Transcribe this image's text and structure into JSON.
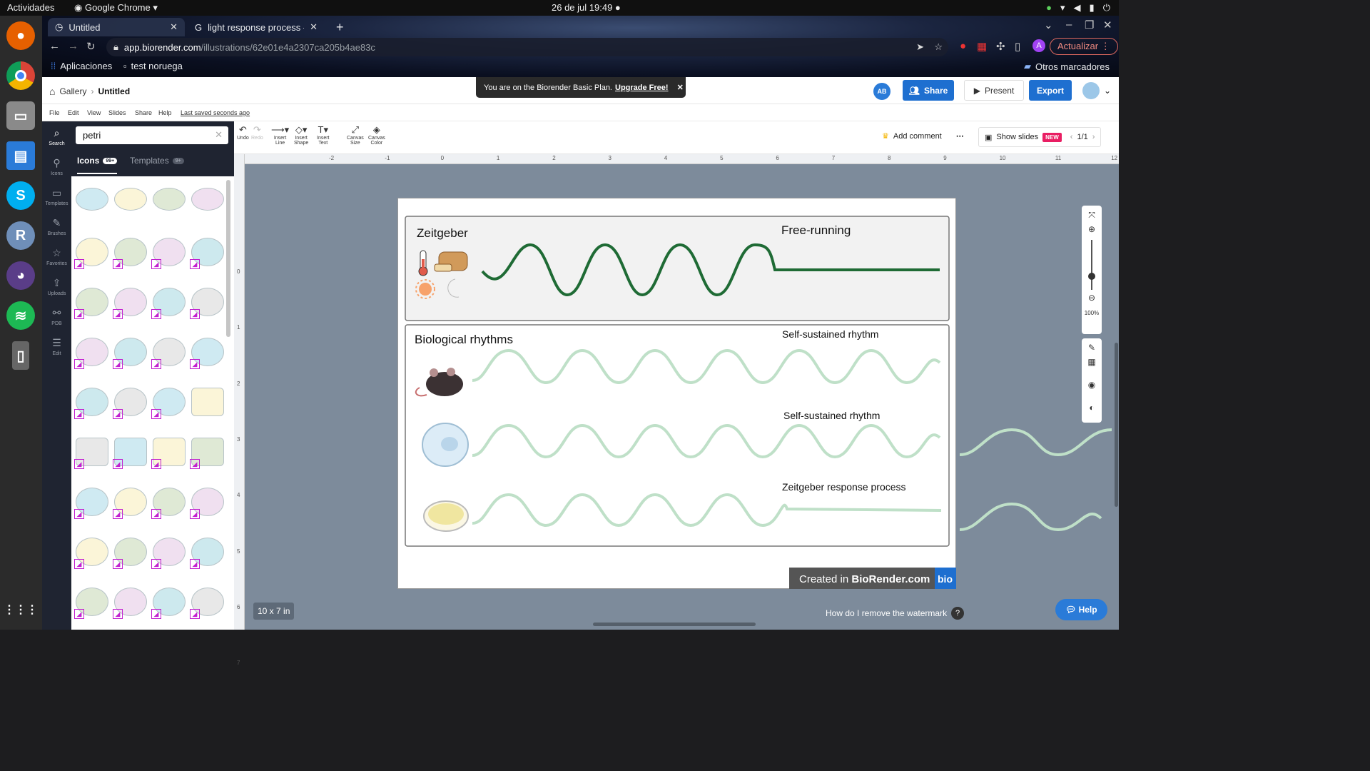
{
  "os": {
    "activities": "Actividades",
    "app_name": "Google Chrome",
    "clock": "26 de jul  19:49"
  },
  "browser": {
    "tabs": [
      {
        "title": "Untitled"
      },
      {
        "title": "light response process - B"
      }
    ],
    "url_host": "app.biorender.com",
    "url_path": "/illustrations/62e01e4a2307ca205b4ae83c",
    "update_label": "Actualizar",
    "profile_initial": "A",
    "bookmarks": [
      {
        "label": "Aplicaciones"
      },
      {
        "label": "test noruega"
      }
    ],
    "other_bookmarks": "Otros marcadores"
  },
  "header": {
    "gallery": "Gallery",
    "doc_title": "Untitled",
    "banner_text": "You are on the Biorender Basic Plan.",
    "banner_link": "Upgrade Free!",
    "avatar": "AB",
    "share": "Share",
    "present": "Present",
    "export": "Export"
  },
  "menu": {
    "items": [
      "File",
      "Edit",
      "View",
      "Slides",
      "Share",
      "Help"
    ],
    "saved": "Last saved seconds ago"
  },
  "rail": [
    {
      "label": "Search",
      "icon": "search-icon"
    },
    {
      "label": "Icons",
      "icon": "icons-icon"
    },
    {
      "label": "Templates",
      "icon": "templates-icon"
    },
    {
      "label": "Brushes",
      "icon": "brush-icon"
    },
    {
      "label": "Favorites",
      "icon": "star-icon"
    },
    {
      "label": "Uploads",
      "icon": "upload-icon"
    },
    {
      "label": "PDB",
      "icon": "molecule-icon"
    },
    {
      "label": "Edit",
      "icon": "sliders-icon"
    }
  ],
  "panel": {
    "search_value": "petri",
    "tab_icons": "Icons",
    "tab_icons_count": "99+",
    "tab_templates": "Templates",
    "tab_templates_count": "9+"
  },
  "toolbar": {
    "undo": "Undo",
    "redo": "Redo",
    "insert_line_1": "Insert",
    "insert_line_2": "Line",
    "insert_shape_1": "Insert",
    "insert_shape_2": "Shape",
    "insert_text_1": "Insert",
    "insert_text_2": "Text",
    "canvas_size_1": "Canvas",
    "canvas_size_2": "Size",
    "canvas_color_1": "Canvas",
    "canvas_color_2": "Color",
    "add_comment": "Add comment",
    "show_slides": "Show slides",
    "new_badge": "NEW",
    "slide_counter": "1/1"
  },
  "rulers": {
    "top": [
      "-2",
      "-1",
      "0",
      "1",
      "2",
      "3",
      "4",
      "5",
      "6",
      "7",
      "8",
      "9",
      "10",
      "11",
      "12"
    ],
    "left": [
      "0",
      "1",
      "2",
      "3",
      "4",
      "5",
      "6",
      "7"
    ]
  },
  "artboard": {
    "box1_title": "Zeitgeber",
    "box1_label": "Free-running",
    "box2_title": "Biological rhythms",
    "row_labels": [
      "Self-sustained rhythm",
      "Self-sustained rhythm",
      "Zeitgeber response process"
    ],
    "watermark_prefix": "Created in ",
    "watermark_brand": "BioRender.com",
    "watermark_logo": "bio"
  },
  "canvas": {
    "size_badge": "10 x 7 in",
    "watermark_question": "How do I remove the watermark",
    "help": "Help",
    "zoom": "100%"
  },
  "colors": {
    "dark_green": "#1f6b35",
    "light_green": "#bfe0c8",
    "primary_blue": "#1e6fd0",
    "rail_bg": "#1f2431"
  }
}
